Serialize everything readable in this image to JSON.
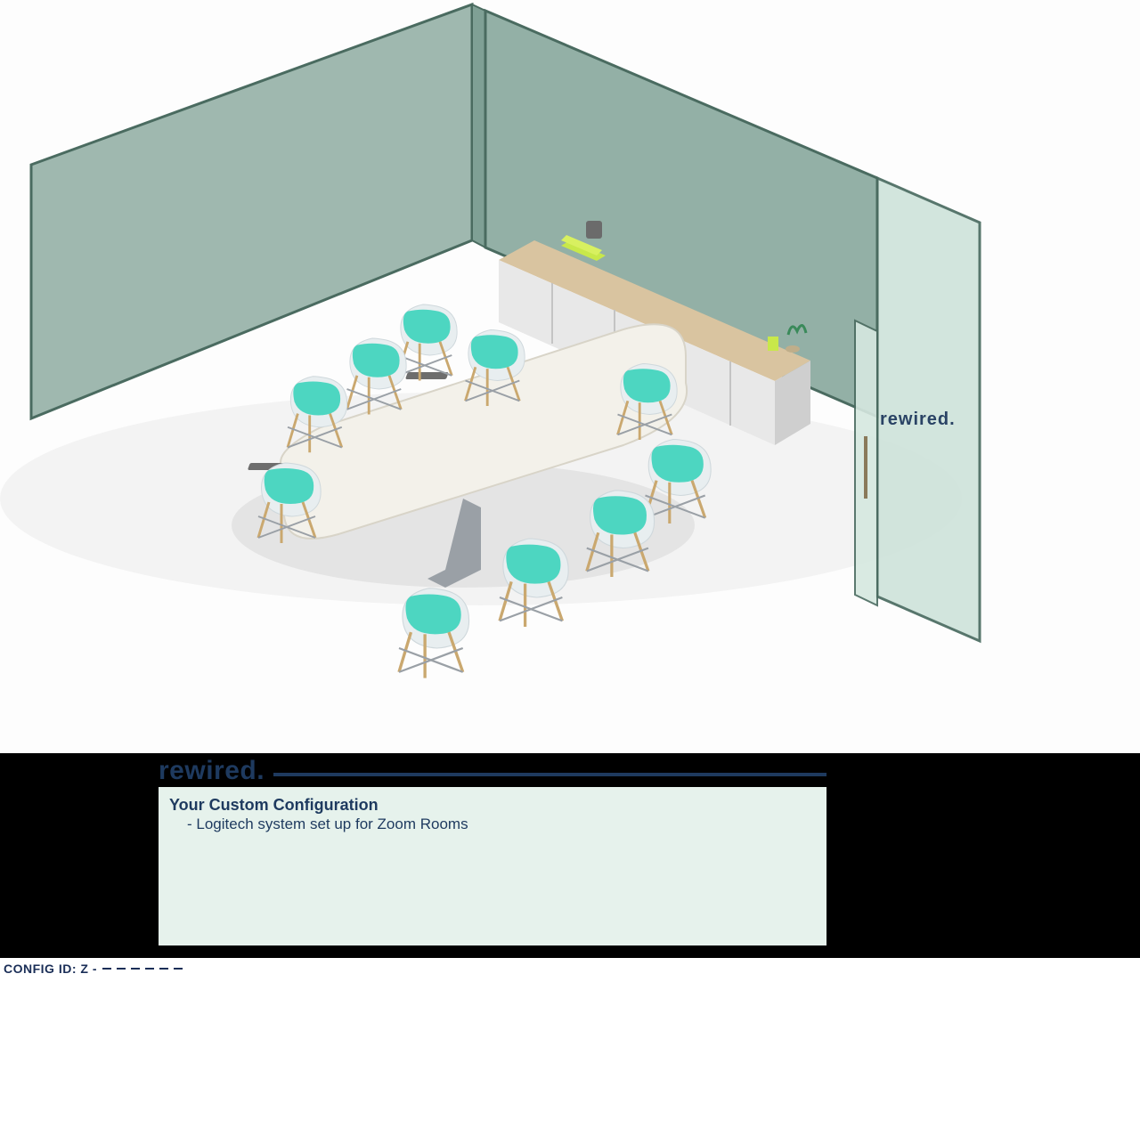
{
  "brand": {
    "logo_text": "rewired.",
    "door_logo_text": "rewired."
  },
  "config_panel": {
    "title": "Your Custom Configuration",
    "items": [
      "- Logitech system set up for Zoom Rooms"
    ]
  },
  "config_id": {
    "label": "CONFIG ID: Z -",
    "segments": 6
  },
  "colors": {
    "wall": "#a8c0b8",
    "wall_edge": "#4a6b60",
    "glass": "#cfe3db",
    "table": "#f3f1ea",
    "chair_seat": "#4dd6c1",
    "chair_shell": "#e8eef0",
    "wood": "#d9c4a0",
    "accent_mint": "#e6f2ec",
    "brand_navy": "#1e3a5f"
  }
}
